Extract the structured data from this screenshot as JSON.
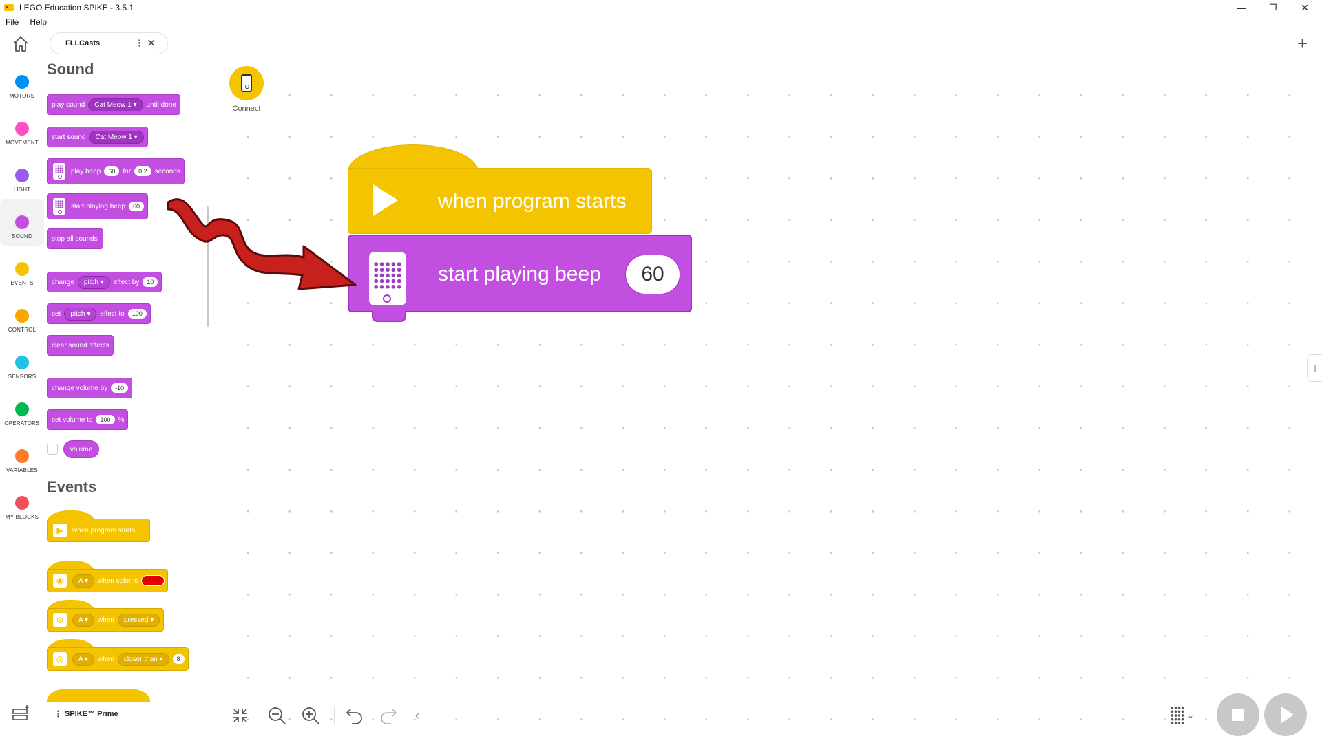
{
  "window": {
    "title": "LEGO Education SPIKE - 3.5.1",
    "minimize": "—",
    "maximize": "❐",
    "close": "✕"
  },
  "menu": {
    "file": "File",
    "help": "Help"
  },
  "tabs": {
    "project_name": "FLLCasts",
    "kebab": "⋮",
    "close": "✕",
    "add": "+"
  },
  "categories": [
    {
      "label": "MOTORS",
      "color": "#0090f5"
    },
    {
      "label": "MOVEMENT",
      "color": "#ff4fc3"
    },
    {
      "label": "LIGHT",
      "color": "#9a5cf0"
    },
    {
      "label": "SOUND",
      "color": "#c24fe0"
    },
    {
      "label": "EVENTS",
      "color": "#f5c400"
    },
    {
      "label": "CONTROL",
      "color": "#f7a800"
    },
    {
      "label": "SENSORS",
      "color": "#1ec3e6"
    },
    {
      "label": "OPERATORS",
      "color": "#00b84d"
    },
    {
      "label": "VARIABLES",
      "color": "#ff7b26"
    },
    {
      "label": "MY BLOCKS",
      "color": "#f0505a"
    }
  ],
  "palette": {
    "sound_title": "Sound",
    "events_title": "Events",
    "play_sound": {
      "a": "play sound",
      "sound": "Cat Meow 1",
      "b": "until done"
    },
    "start_sound": {
      "a": "start sound",
      "sound": "Cat Meow 1"
    },
    "play_beep": {
      "a": "play beep",
      "note": "60",
      "b": "for",
      "dur": "0.2",
      "c": "seconds"
    },
    "start_beep": {
      "a": "start playing beep",
      "note": "60"
    },
    "stop_all": "stop all sounds",
    "change_effect": {
      "a": "change",
      "effect": "pitch",
      "b": "effect by",
      "val": "10"
    },
    "set_effect": {
      "a": "set",
      "effect": "pitch",
      "b": "effect to",
      "val": "100"
    },
    "clear_effects": "clear sound effects",
    "change_volume": {
      "a": "change volume by",
      "val": "-10"
    },
    "set_volume": {
      "a": "set volume to",
      "val": "100",
      "unit": "%"
    },
    "volume": "volume",
    "when_program_starts": "when program starts",
    "when_color": {
      "port": "A",
      "a": "when color is"
    },
    "when_pressed": {
      "port": "A",
      "a": "when",
      "state": "pressed"
    },
    "when_closer": {
      "port": "A",
      "a": "when",
      "cmp": "closer than",
      "val": "8"
    }
  },
  "workspace": {
    "connect_label": "Connect",
    "hat_text": "when program starts",
    "beep_text": "start playing beep",
    "beep_value": "60"
  },
  "footer": {
    "device": "SPIKE™ Prime"
  }
}
